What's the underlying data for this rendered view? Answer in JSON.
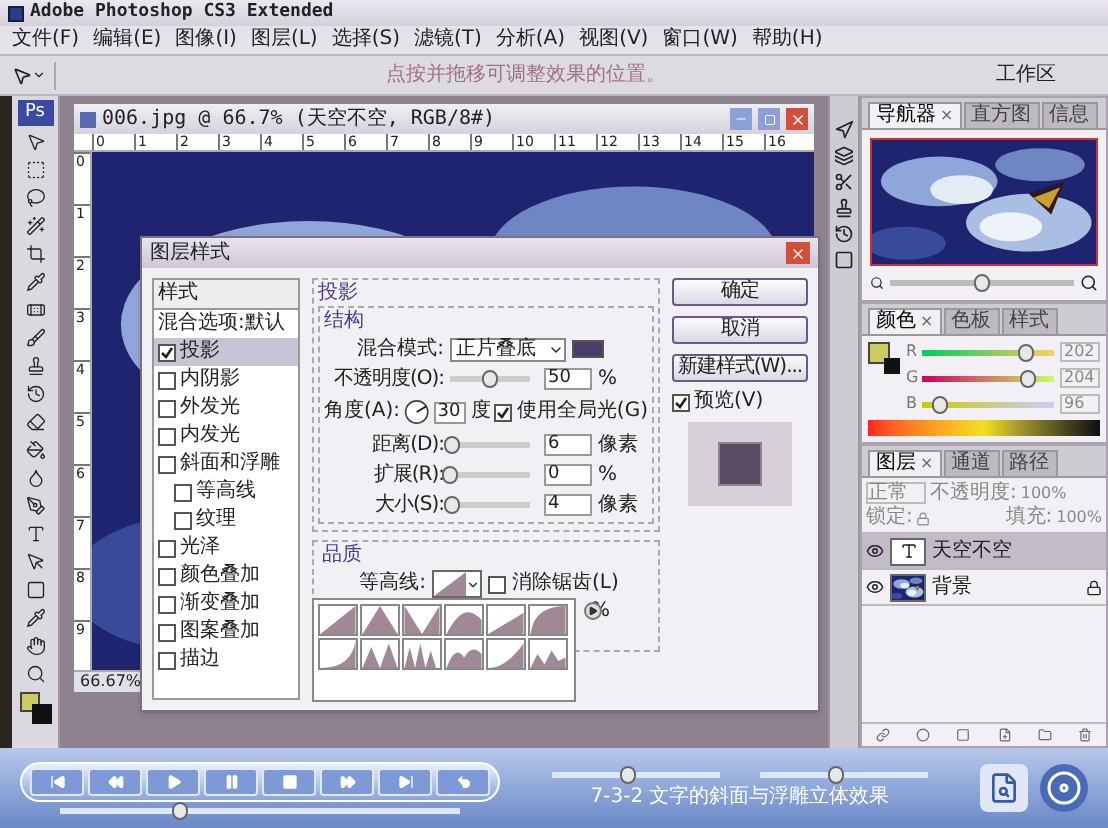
{
  "app": {
    "title": "Adobe Photoshop CS3 Extended"
  },
  "menu": [
    "文件(F)",
    "编辑(E)",
    "图像(I)",
    "图层(L)",
    "选择(S)",
    "滤镜(T)",
    "分析(A)",
    "视图(V)",
    "窗口(W)",
    "帮助(H)"
  ],
  "options_bar": {
    "hint": "点按并拖移可调整效果的位置。",
    "workspace": "工作区"
  },
  "toolbox": {
    "logo": "Ps"
  },
  "document": {
    "title": "006.jpg @ 66.7% (天空不空, RGB/8#)",
    "ruler_marks": [
      "0",
      "1",
      "2",
      "3",
      "4",
      "5",
      "6",
      "7",
      "8",
      "9",
      "10",
      "11",
      "12",
      "13",
      "14",
      "15",
      "16"
    ],
    "vertical_ruler_marks": [
      "0",
      "1",
      "2",
      "3",
      "4",
      "5",
      "6",
      "7",
      "8",
      "9"
    ],
    "zoom": "66.67%"
  },
  "dialog": {
    "title": "图层样式",
    "styles_header": "样式",
    "blend_options": "混合选项:默认",
    "effects": [
      {
        "label": "投影",
        "checked": true,
        "selected": true
      },
      {
        "label": "内阴影",
        "checked": false,
        "selected": false
      },
      {
        "label": "外发光",
        "checked": false,
        "selected": false
      },
      {
        "label": "内发光",
        "checked": false,
        "selected": false
      },
      {
        "label": "斜面和浮雕",
        "checked": false,
        "selected": false,
        "children": [
          {
            "label": "等高线",
            "checked": false,
            "selected": false
          },
          {
            "label": "纹理",
            "checked": false,
            "selected": false
          }
        ]
      },
      {
        "label": "光泽",
        "checked": false,
        "selected": false
      },
      {
        "label": "颜色叠加",
        "checked": false,
        "selected": false
      },
      {
        "label": "渐变叠加",
        "checked": false,
        "selected": false
      },
      {
        "label": "图案叠加",
        "checked": false,
        "selected": false
      },
      {
        "label": "描边",
        "checked": false,
        "selected": false
      }
    ],
    "section": "投影",
    "structure": "结构",
    "blend_mode": {
      "label": "混合模式:",
      "value": "正片叠底"
    },
    "angle": {
      "label": "角度(A):",
      "value": "30",
      "unit": "度",
      "global_light": {
        "label": "使用全局光(G)",
        "checked": true
      }
    },
    "rows": [
      {
        "label": "不透明度(O):",
        "level": 0.5,
        "value": "50",
        "unit": "%"
      },
      {
        "label": "距离(D):",
        "level": 0.03,
        "value": "6",
        "unit": "像素"
      },
      {
        "label": "扩展(R):",
        "level": 0,
        "value": "0",
        "unit": "%"
      },
      {
        "label": "大小(S):",
        "level": 0.03,
        "value": "4",
        "unit": "像素"
      }
    ],
    "quality": "品质",
    "contour_label": "等高线:",
    "anti_alias": {
      "label": "消除锯齿(L)",
      "checked": false
    },
    "noise_unit": "%",
    "buttons": [
      "确定",
      "取消",
      "新建样式(W)..."
    ],
    "preview": {
      "label": "预览(V)",
      "checked": true
    }
  },
  "panels": {
    "close_mark": "×",
    "navigator": {
      "tabs": [
        {
          "label": "导航器",
          "selected": true
        },
        {
          "label": "直方图",
          "selected": false
        },
        {
          "label": "信息",
          "selected": false
        }
      ],
      "zoom": {
        "level": 0.5
      }
    },
    "color": {
      "tabs": [
        {
          "label": "颜色",
          "selected": true
        },
        {
          "label": "色板",
          "selected": false
        },
        {
          "label": "样式",
          "selected": false
        }
      ],
      "channels": [
        {
          "label": "R",
          "value": "202",
          "level": 0.79
        },
        {
          "label": "G",
          "value": "204",
          "level": 0.8
        },
        {
          "label": "B",
          "value": "96",
          "level": 0.14
        }
      ]
    },
    "layers": {
      "tabs": [
        {
          "label": "图层",
          "selected": true
        },
        {
          "label": "通道",
          "selected": false
        },
        {
          "label": "路径",
          "selected": false
        }
      ],
      "blend": "正常",
      "opacity_label": "不透明度:",
      "opacity": "100%",
      "lock_label": "锁定:",
      "fill_label": "填充:",
      "fill": "100%",
      "items": [
        {
          "kind": "text",
          "name": "天空不空",
          "selected": true,
          "visible": true,
          "locked": false
        },
        {
          "name": "背景",
          "selected": false,
          "visible": true,
          "locked": true
        }
      ]
    }
  },
  "player": {
    "title": "7-3-2 文字的斜面与浮雕立体效果",
    "progress": {
      "level": 0.3
    },
    "sliders": [
      {
        "level": 0.45
      },
      {
        "level": 0.45
      }
    ]
  }
}
